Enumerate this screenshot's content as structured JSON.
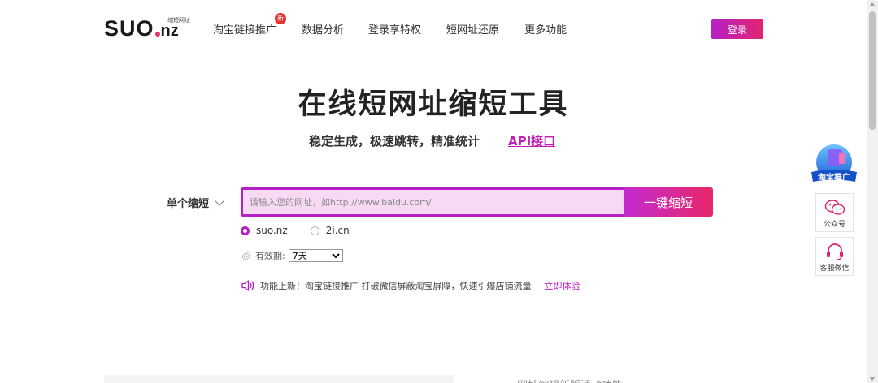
{
  "header": {
    "logo_main": "SUO",
    "logo_tld": "nz",
    "logo_tagline": "缩短网址",
    "nav": [
      {
        "label": "淘宝链接推广",
        "badge": "新"
      },
      {
        "label": "数据分析"
      },
      {
        "label": "登录享特权"
      },
      {
        "label": "短网址还原"
      },
      {
        "label": "更多功能"
      }
    ],
    "login_label": "登录"
  },
  "hero": {
    "title": "在线短网址缩短工具",
    "subtitle": "稳定生成，极速跳转，精准统计",
    "api_link": "API接口"
  },
  "shortener": {
    "mode": "单个缩短",
    "input_placeholder": "请输入您的网址，如http://www.baidu.com/",
    "button_label": "一键缩短",
    "domains": [
      {
        "label": "suo.nz",
        "selected": true
      },
      {
        "label": "2i.cn",
        "selected": false
      }
    ],
    "validity_label": "有效期:",
    "validity_value": "7天"
  },
  "notice": {
    "text": "功能上新！淘宝链接推广 打破微信屏蔽淘宝屏障，快速引爆店铺流量",
    "link": "立即体验"
  },
  "side": {
    "promo_text": "淘宝推广",
    "wechat_label": "公众号",
    "service_label": "客服微信"
  },
  "bottom": {
    "partial_text": "网址缩短新版活动功能"
  },
  "colors": {
    "accent_purple": "#b620c8",
    "accent_pink": "#e2246e",
    "input_bg": "#f7d9f4"
  }
}
